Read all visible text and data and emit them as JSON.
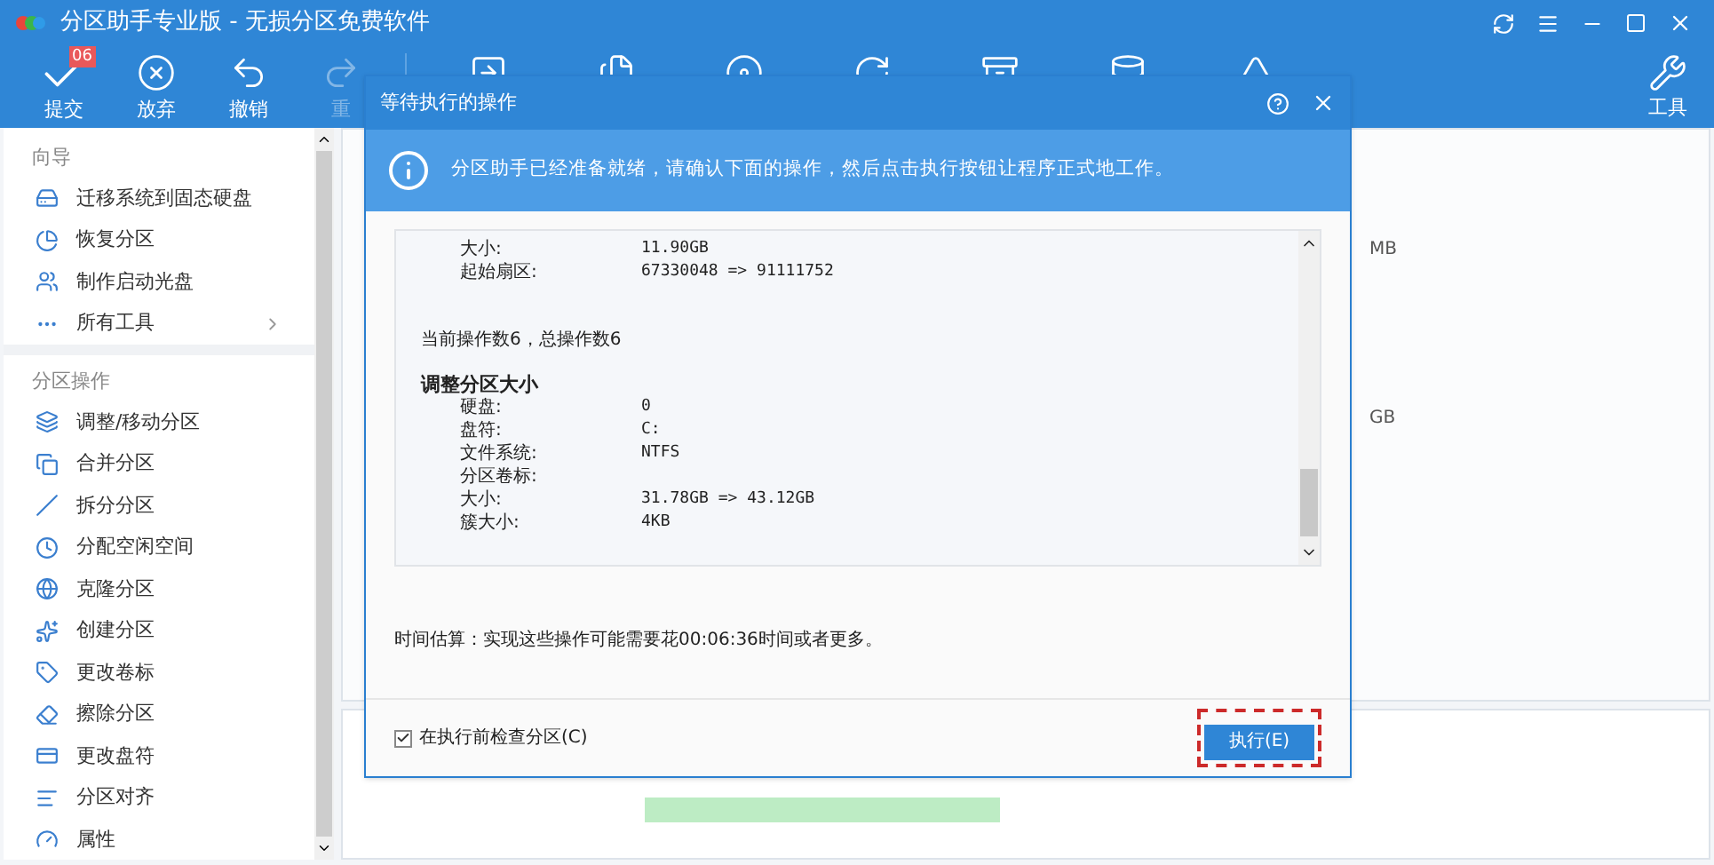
{
  "window": {
    "title": "分区助手专业版 - 无损分区免费软件"
  },
  "toolbar": [
    {
      "label": "提交",
      "disabled": false,
      "badge": "06"
    },
    {
      "label": "放弃",
      "disabled": false
    },
    {
      "label": "撤销",
      "disabled": false
    },
    {
      "label": "重",
      "disabled": true
    }
  ],
  "tools_button": {
    "label": "工具"
  },
  "sidebar": [
    {
      "title": "向导",
      "items": [
        {
          "label": "迁移系统到固态硬盘",
          "submenu": false
        },
        {
          "label": "恢复分区",
          "submenu": false
        },
        {
          "label": "制作启动光盘",
          "submenu": false
        },
        {
          "label": "所有工具",
          "submenu": true
        }
      ]
    },
    {
      "title": "分区操作",
      "items": [
        {
          "label": "调整/移动分区",
          "submenu": false
        },
        {
          "label": "合并分区",
          "submenu": false
        },
        {
          "label": "拆分分区",
          "submenu": false
        },
        {
          "label": "分配空闲空间",
          "submenu": false
        },
        {
          "label": "克隆分区",
          "submenu": false
        },
        {
          "label": "创建分区",
          "submenu": false
        },
        {
          "label": "更改卷标",
          "submenu": false
        },
        {
          "label": "擦除分区",
          "submenu": false
        },
        {
          "label": "更改盘符",
          "submenu": false
        },
        {
          "label": "分区对齐",
          "submenu": false
        },
        {
          "label": "属性",
          "submenu": false
        }
      ]
    }
  ],
  "disk_labels": [
    "MB",
    "GB"
  ],
  "dialog": {
    "title": "等待执行的操作",
    "info": "分区助手已经准备就绪，请确认下面的操作，然后点击执行按钮让程序正式地工作。",
    "details": {
      "top_rows": [
        {
          "label": "大小:",
          "value": "11.90GB"
        },
        {
          "label": "起始扇区:",
          "value": "67330048 => 91111752"
        }
      ],
      "summary": "当前操作数6，总操作数6",
      "operation": "调整分区大小",
      "rows": [
        {
          "label": "硬盘:",
          "value": "0"
        },
        {
          "label": "盘符:",
          "value": "C:"
        },
        {
          "label": "文件系统:",
          "value": "NTFS"
        },
        {
          "label": "分区卷标:",
          "value": ""
        },
        {
          "label": "大小:",
          "value": "31.78GB => 43.12GB"
        },
        {
          "label": "簇大小:",
          "value": "4KB"
        }
      ]
    },
    "estimate": "时间估算：实现这些操作可能需要花00:06:36时间或者更多。",
    "check_option": {
      "label": "在执行前检查分区(C)",
      "checked": true
    },
    "execute_button": {
      "label": "执行(E)"
    }
  }
}
